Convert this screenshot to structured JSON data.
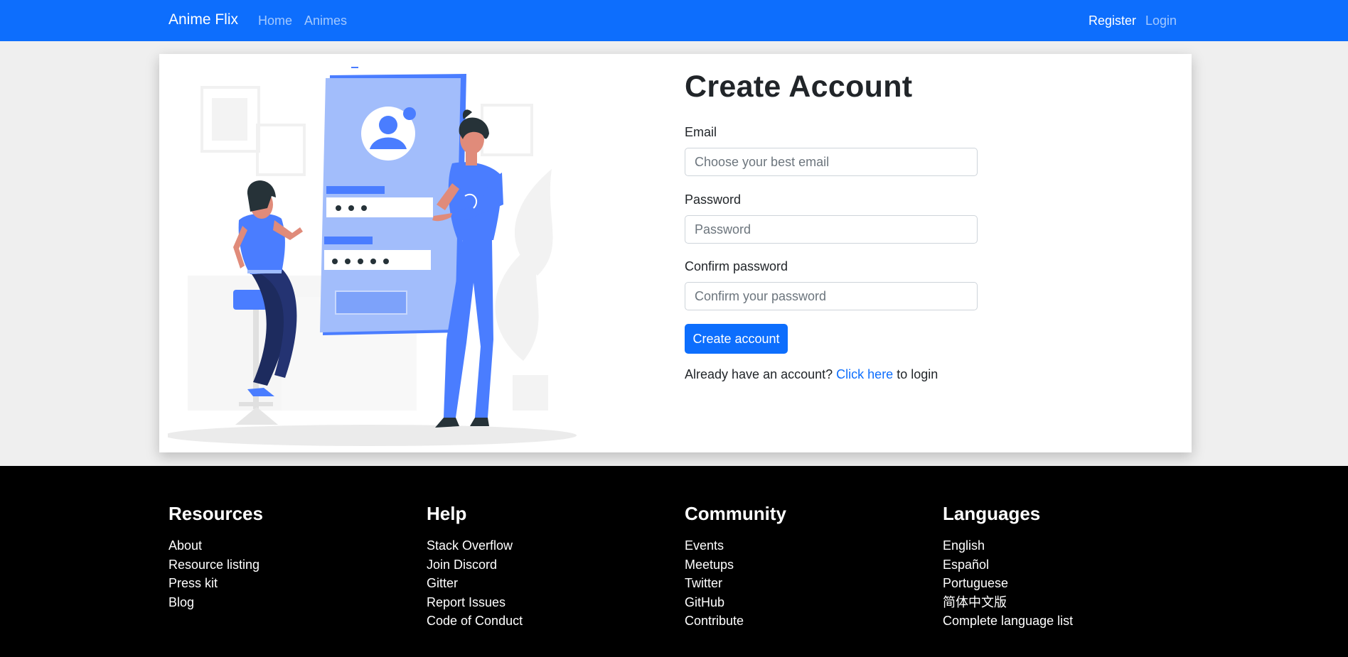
{
  "navbar": {
    "brand": "Anime Flix",
    "links": [
      {
        "label": "Home"
      },
      {
        "label": "Animes"
      }
    ],
    "register": "Register",
    "login": "Login",
    "background": "#0d6efd"
  },
  "form": {
    "title": "Create Account",
    "email_label": "Email",
    "email_placeholder": "Choose your best email",
    "password_label": "Password",
    "password_placeholder": "Password",
    "confirm_label": "Confirm password",
    "confirm_placeholder": "Confirm your password",
    "submit_label": "Create account",
    "login_prefix": "Already have an account?",
    "login_link": "Click here",
    "login_suffix": "to login"
  },
  "illustration": {
    "icon": "signup-illustration-icon",
    "accent": "#4a7dff"
  },
  "footer": {
    "columns": [
      {
        "title": "Resources",
        "links": [
          "About",
          "Resource listing",
          "Press kit",
          "Blog"
        ]
      },
      {
        "title": "Help",
        "links": [
          "Stack Overflow",
          "Join Discord",
          "Gitter",
          "Report Issues",
          "Code of Conduct"
        ]
      },
      {
        "title": "Community",
        "links": [
          "Events",
          "Meetups",
          "Twitter",
          "GitHub",
          "Contribute"
        ]
      },
      {
        "title": "Languages",
        "links": [
          "English",
          "Español",
          "Portuguese",
          "简体中文版",
          "Complete language list"
        ]
      }
    ]
  }
}
